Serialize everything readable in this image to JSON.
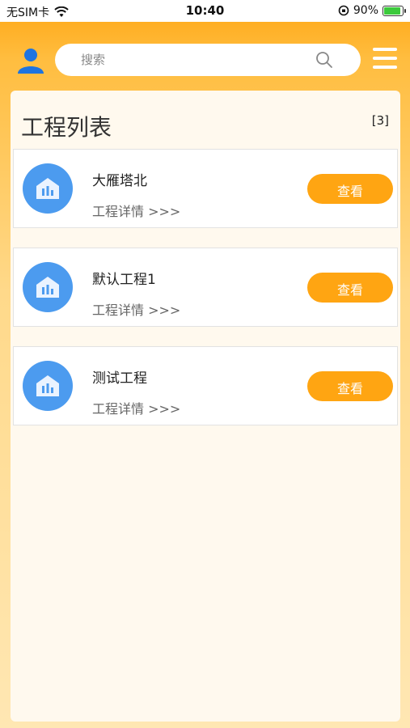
{
  "status_bar": {
    "carrier": "无SIM卡",
    "time": "10:40",
    "battery_pct": "90%",
    "battery_level": 0.9
  },
  "search": {
    "placeholder": "搜索"
  },
  "panel": {
    "title": "工程列表",
    "count": "[3]"
  },
  "projects": [
    {
      "name": "大雁塔北",
      "detail_link": "工程详情 >>>",
      "view_label": "查看"
    },
    {
      "name": "默认工程1",
      "detail_link": "工程详情 >>>",
      "view_label": "查看"
    },
    {
      "name": "测试工程",
      "detail_link": "工程详情 >>>",
      "view_label": "查看"
    }
  ],
  "colors": {
    "accent": "#ffa512",
    "avatar_blue": "#4c9bef"
  }
}
